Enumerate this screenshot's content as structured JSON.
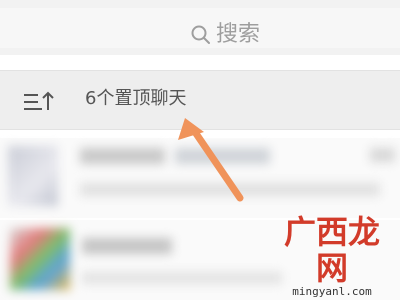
{
  "search": {
    "placeholder": "搜索",
    "icon": "search-icon"
  },
  "pinned": {
    "label": "6个置顶聊天",
    "icon": "sort-icon"
  },
  "chat_list": {
    "items": [
      {
        "blurred": true
      },
      {
        "blurred": true
      }
    ]
  },
  "watermark": {
    "text_cn": "广西龙网",
    "text_en": "mingyanl.com"
  },
  "colors": {
    "arrow": "#f0935a",
    "watermark": "#d23b2a"
  }
}
